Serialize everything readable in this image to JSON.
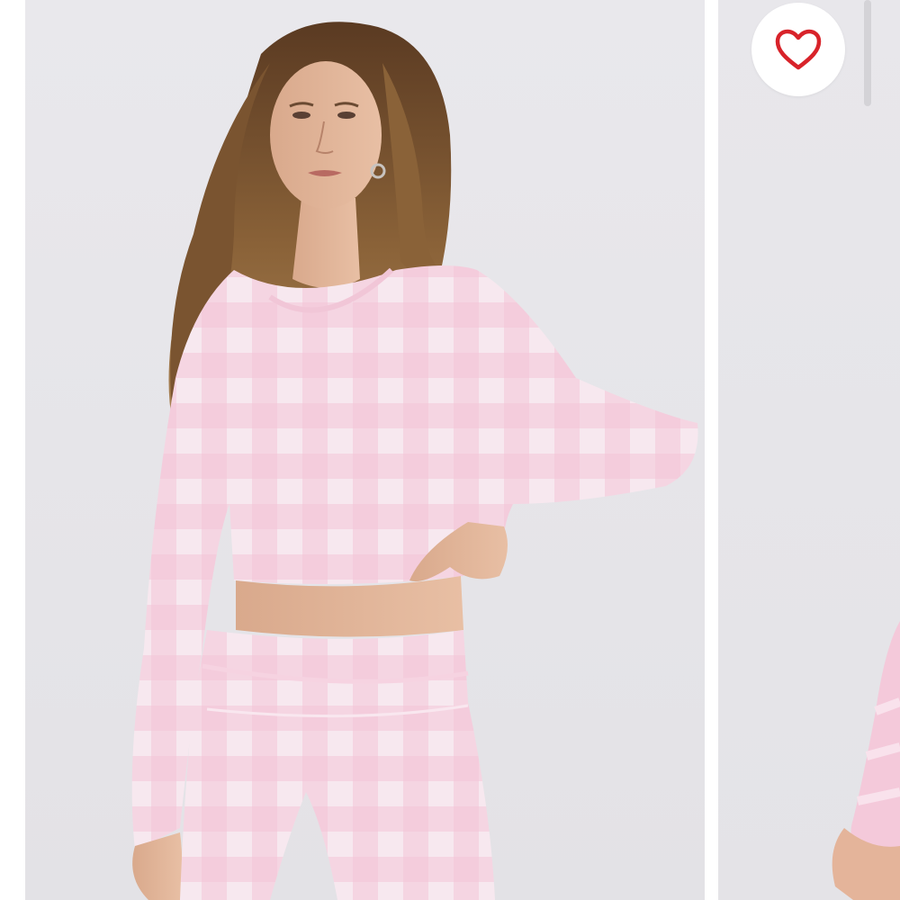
{
  "gallery": {
    "main_image": {
      "alt": ""
    },
    "next_image": {
      "alt": ""
    },
    "favorite": {
      "icon": "heart-outline-icon",
      "liked": false,
      "color": "#d8232a"
    }
  },
  "colors": {
    "background": "#e8e7eb",
    "garment_light": "#f6e6ee",
    "garment_pink": "#f2b8cf",
    "heart": "#d8232a"
  }
}
